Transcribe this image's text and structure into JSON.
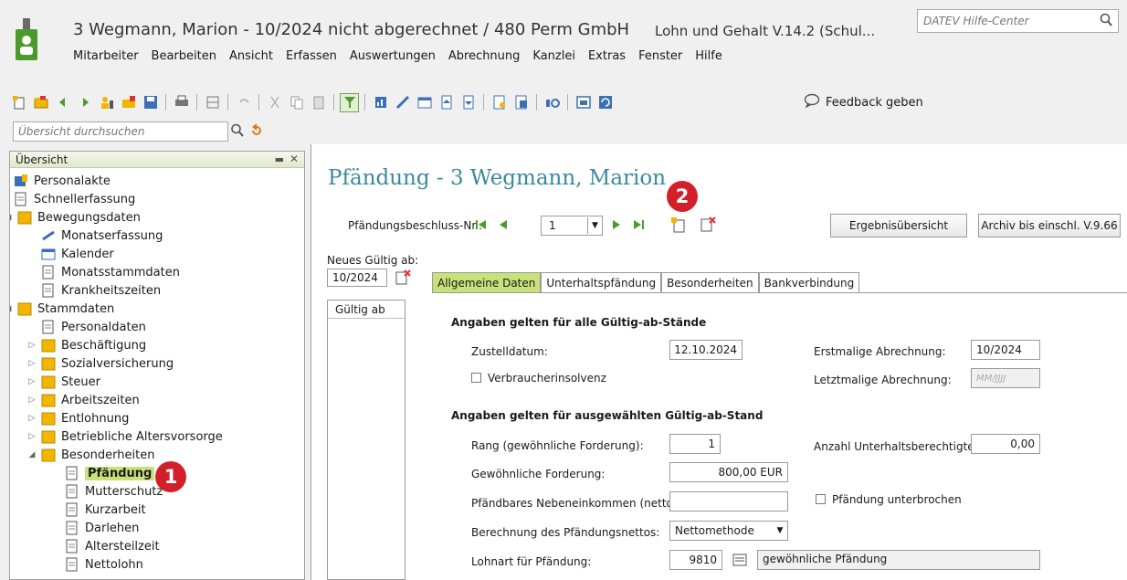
{
  "window": {
    "title": "3 Wegmann, Marion - 10/2024 nicht abgerechnet / 480 Perm GmbH",
    "app_version": "Lohn und Gehalt V.14.2 (Schul..."
  },
  "help_search": {
    "placeholder": "DATEV Hilfe-Center"
  },
  "menu": [
    "Mitarbeiter",
    "Bearbeiten",
    "Ansicht",
    "Erfassen",
    "Auswertungen",
    "Abrechnung",
    "Kanzlei",
    "Extras",
    "Fenster",
    "Hilfe"
  ],
  "toolbar": {
    "feedback_label": "Feedback geben"
  },
  "overview_search": {
    "placeholder": "Übersicht durchsuchen"
  },
  "overview": {
    "header": "Übersicht",
    "items": [
      {
        "label": "Personalakte"
      },
      {
        "label": "Schnellerfassung"
      },
      {
        "label": "Bewegungsdaten"
      },
      {
        "label": "Monatserfassung"
      },
      {
        "label": "Kalender"
      },
      {
        "label": "Monatsstammdaten"
      },
      {
        "label": "Krankheitszeiten"
      },
      {
        "label": "Stammdaten"
      },
      {
        "label": "Personaldaten"
      },
      {
        "label": "Beschäftigung"
      },
      {
        "label": "Sozialversicherung"
      },
      {
        "label": "Steuer"
      },
      {
        "label": "Arbeitszeiten"
      },
      {
        "label": "Entlohnung"
      },
      {
        "label": "Betriebliche Altersvorsorge"
      },
      {
        "label": "Besonderheiten"
      },
      {
        "label": "Pfändung"
      },
      {
        "label": "Mutterschutz"
      },
      {
        "label": "Kurzarbeit"
      },
      {
        "label": "Darlehen"
      },
      {
        "label": "Altersteilzeit"
      },
      {
        "label": "Nettolohn"
      }
    ]
  },
  "main": {
    "title": "Pfändung - 3 Wegmann, Marion",
    "beschluss_label": "Pfändungsbeschluss-Nr.:",
    "beschluss_value": "1",
    "btn_ergebnis": "Ergebnisübersicht",
    "btn_archiv": "Archiv bis einschl. V.9.66",
    "neues_gueltig_label": "Neues Gültig ab:",
    "neues_gueltig_value": "10/2024",
    "gueltig_list_header": "Gültig ab",
    "tabs": [
      "Allgemeine Daten",
      "Unterhaltspfändung",
      "Besonderheiten",
      "Bankverbindung"
    ],
    "section1": "Angaben gelten für alle Gültig-ab-Stände",
    "zustelldatum_label": "Zustelldatum:",
    "zustelldatum_value": "12.10.2024",
    "erstmalige_label": "Erstmalige Abrechnung:",
    "erstmalige_value": "10/2024",
    "verbraucher_label": "Verbraucherinsolvenz",
    "letztmalige_label": "Letztmalige Abrechnung:",
    "letztmalige_placeholder": "MM/JJJJ",
    "section2": "Angaben gelten für ausgewählten Gültig-ab-Stand",
    "rang_label": "Rang (gewöhnliche Forderung):",
    "rang_value": "1",
    "anzahl_label": "Anzahl Unterhaltsberechtigte:",
    "anzahl_value": "0,00",
    "forderung_label": "Gewöhnliche Forderung:",
    "forderung_value": "800,00 EUR",
    "neben_label": "Pfändbares Nebeneinkommen (netto):",
    "neben_value": "",
    "unterbrochen_label": "Pfändung unterbrochen",
    "berechnung_label": "Berechnung des Pfändungsnettos:",
    "berechnung_value": "Nettomethode",
    "lohnart_label": "Lohnart für Pfändung:",
    "lohnart_value": "9810",
    "lohnart_desc": "gewöhnliche Pfändung"
  },
  "callouts": {
    "one": "1",
    "two": "2"
  },
  "colors": {
    "accent_green": "#c8e17a",
    "title_teal": "#3a8a9c",
    "callout_red": "#d21f2a"
  }
}
